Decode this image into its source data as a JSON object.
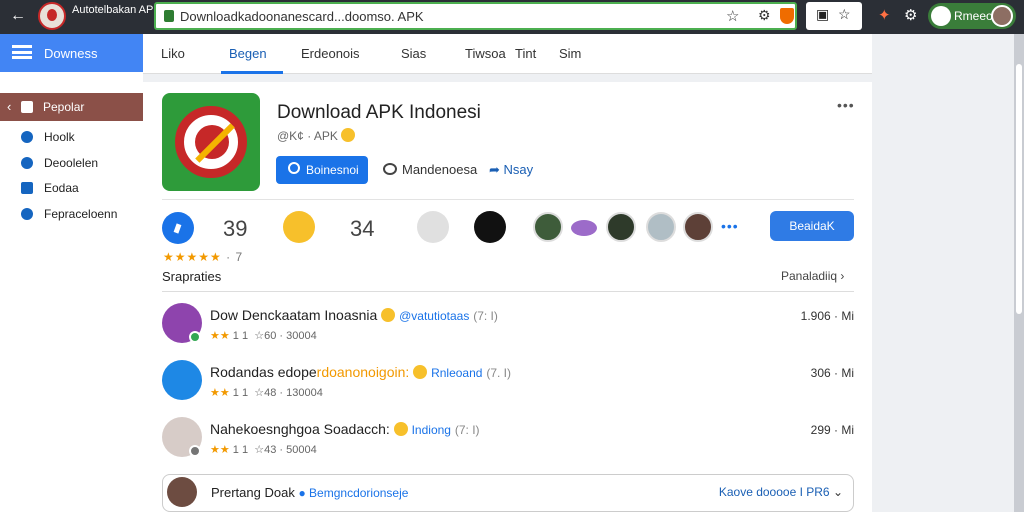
{
  "browser": {
    "app_name": "Autotelbakan APP",
    "url": "Downloadkadoonanescard...doomso. APK",
    "profile_label": "Rmeeo"
  },
  "sidebar": {
    "title": "Downess",
    "active": "Pepolar",
    "items": [
      {
        "label": "Hoolk"
      },
      {
        "label": "Deoolelen"
      },
      {
        "label": "Eodaa"
      },
      {
        "label": "Fepraceloenn"
      }
    ]
  },
  "tabs": [
    {
      "label": "Liko"
    },
    {
      "label": "Begen"
    },
    {
      "label": "Erdeonois"
    },
    {
      "label": "Sias"
    },
    {
      "label": "Tiwsoa"
    },
    {
      "label": "Tint"
    },
    {
      "label": "Sim"
    }
  ],
  "app": {
    "title": "Download APK Indonesi",
    "meta": "@K¢ · APK",
    "primary_button": "Boinesnoi",
    "button2": "Mandenoesa",
    "button3": "Nsay"
  },
  "reactions": {
    "count1": "39",
    "count2": "34",
    "join_button": "BeaidaK",
    "rating": "· 7"
  },
  "section": {
    "label": "Srapraties",
    "link": "Panaladiiq"
  },
  "list": [
    {
      "title": "Dow Denckaatam Inoasnia",
      "tag": "@vatutiotaas",
      "tag2": "(7: I)",
      "rating": "1 1",
      "sub": "60 · 30004",
      "size": "1.906 · Mi"
    },
    {
      "title": "Rodandas edope",
      "highlight": "rdoanonoigoin:",
      "tag": "Rnleoand",
      "tag2": "(7. I)",
      "rating": "1 1",
      "sub": "48 · 130004",
      "size": "306 · Mi"
    },
    {
      "title": "Nahekoesnghgoa Soadacch:",
      "tag": "Indiong",
      "tag2": "(7: I)",
      "rating": "1 1",
      "sub": "43 · 50004",
      "size": "299 · Mi"
    }
  ],
  "bottom": {
    "title": "Prertang Doak",
    "tag": "Bemgncdorionseje",
    "right": "Kaove dooooe I PR6"
  }
}
